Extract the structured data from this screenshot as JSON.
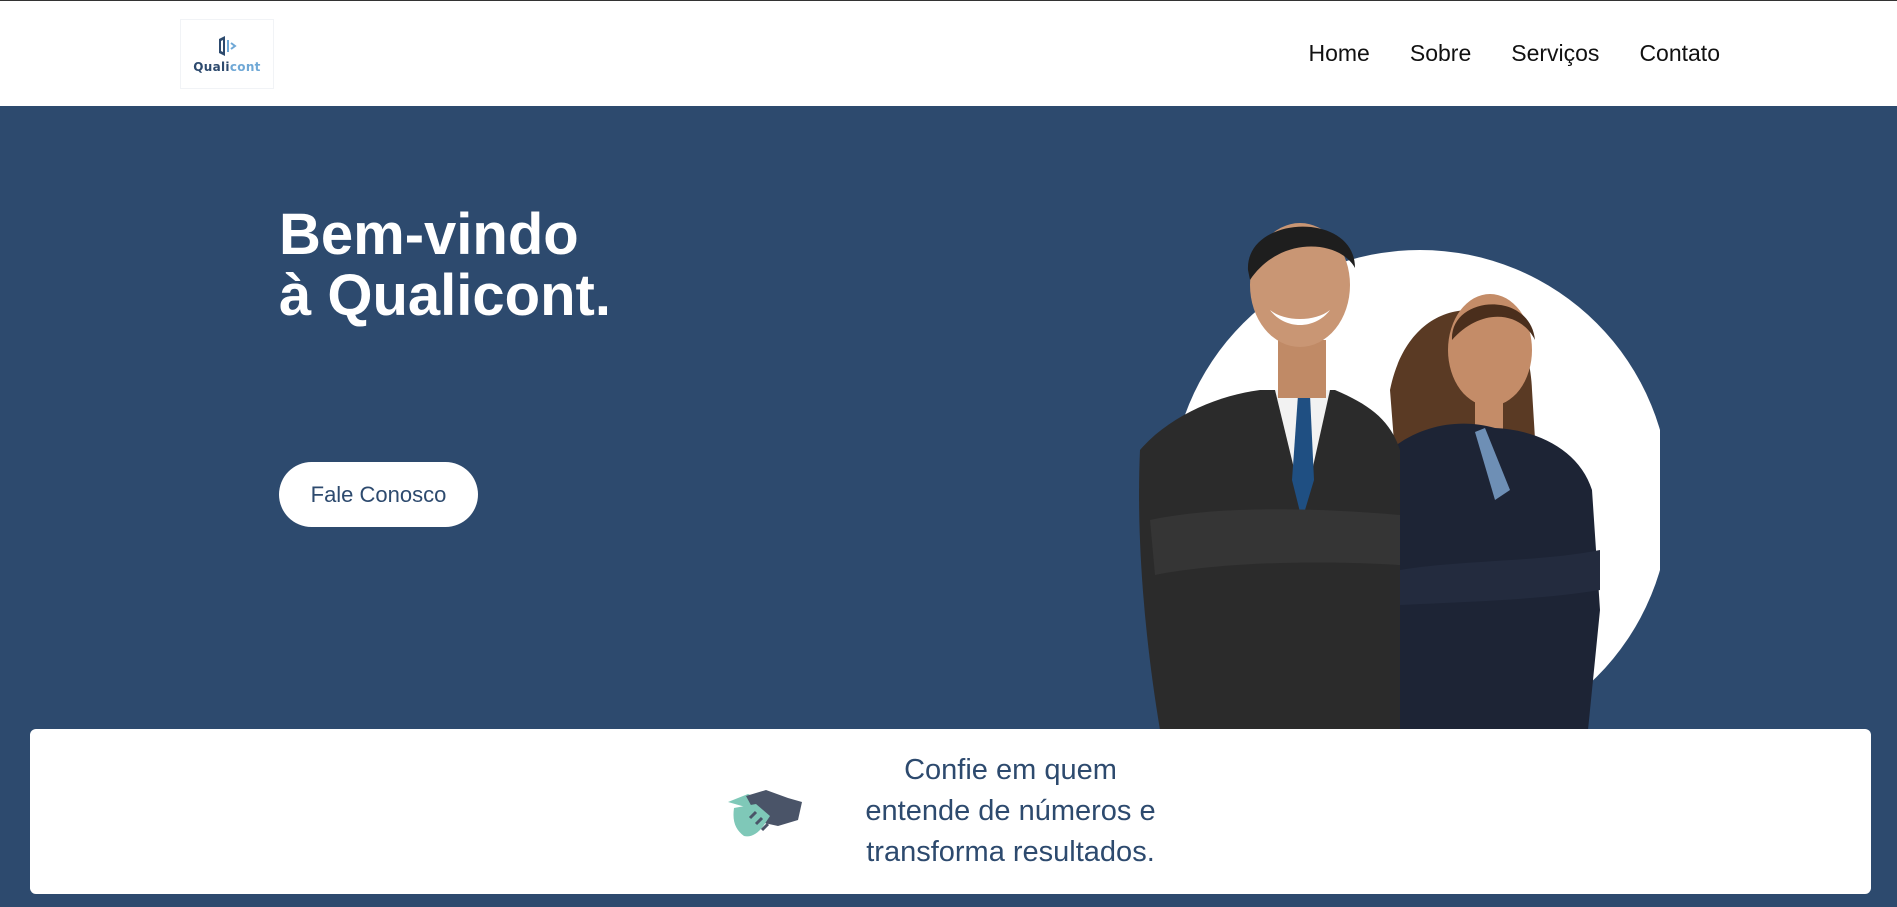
{
  "header": {
    "logo": {
      "text_main": "Quali",
      "text_accent": "cont"
    },
    "nav": [
      {
        "label": "Home"
      },
      {
        "label": "Sobre"
      },
      {
        "label": "Serviços"
      },
      {
        "label": "Contato"
      }
    ]
  },
  "hero": {
    "title_line1": "Bem-vindo",
    "title_line2": "à Qualicont.",
    "cta_label": "Fale Conosco",
    "image": "two-professionals-arms-crossed"
  },
  "card": {
    "icon": "handshake-icon",
    "line1": "Confie em quem",
    "line2": "entende de números e",
    "line3": "transforma resultados."
  },
  "colors": {
    "primary": "#2d4a6e",
    "accent": "#6fa8d6",
    "handshake_teal": "#7fc8b8",
    "white": "#ffffff"
  }
}
